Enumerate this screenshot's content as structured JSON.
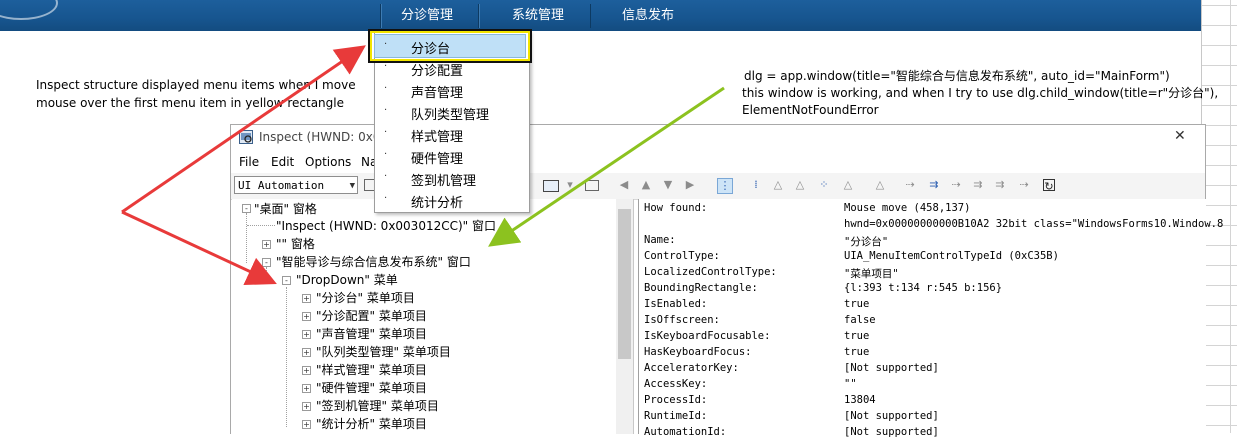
{
  "topbar": {
    "items": [
      "分诊管理",
      "系统管理",
      "信息发布"
    ],
    "bg_color": "#17558f"
  },
  "dropdown": {
    "items": [
      "分诊台",
      "分诊配置",
      "声音管理",
      "队列类型管理",
      "样式管理",
      "硬件管理",
      "签到机管理",
      "统计分析"
    ],
    "highlight_color": "#bfe0f7",
    "frame_color": "#f2e500"
  },
  "annotations": {
    "left_note": [
      "Inspect structure displayed menu items when I move",
      "mouse over the first menu item in yellow rectangle"
    ],
    "right_note": [
      "dlg = app.window(title=\"智能综合与信息发布系统\", auto_id=\"MainForm\")",
      "this window is working, and when I try to use dlg.child_window(title=r\"分诊台\"),",
      "ElementNotFoundError"
    ],
    "arrow_colors": {
      "red": "#e83a3a",
      "green": "#8cc21f"
    }
  },
  "inspect": {
    "title": "Inspect  (HWND: 0x0",
    "menu": [
      "File",
      "Edit",
      "Options",
      "Na"
    ],
    "mode": "UI Automation",
    "tree": [
      {
        "text": "\"桌面\" 窗格",
        "level": 0,
        "box": "-"
      },
      {
        "text": "\"Inspect  (HWND: 0x003012CC)\" 窗口",
        "level": 1,
        "box": ""
      },
      {
        "text": "\"\" 窗格",
        "level": 1,
        "box": "+"
      },
      {
        "text": "\"智能导诊与综合信息发布系统\" 窗口",
        "level": 1,
        "box": "-"
      },
      {
        "text": "\"DropDown\" 菜单",
        "level": 2,
        "box": "-"
      },
      {
        "text": "\"分诊台\" 菜单项目",
        "level": 3,
        "box": "+"
      },
      {
        "text": "\"分诊配置\" 菜单项目",
        "level": 3,
        "box": "+"
      },
      {
        "text": "\"声音管理\" 菜单项目",
        "level": 3,
        "box": "+"
      },
      {
        "text": "\"队列类型管理\" 菜单项目",
        "level": 3,
        "box": "+"
      },
      {
        "text": "\"样式管理\" 菜单项目",
        "level": 3,
        "box": "+"
      },
      {
        "text": "\"硬件管理\" 菜单项目",
        "level": 3,
        "box": "+"
      },
      {
        "text": "\"签到机管理\" 菜单项目",
        "level": 3,
        "box": "+"
      },
      {
        "text": "\"统计分析\" 菜单项目",
        "level": 3,
        "box": "+"
      }
    ],
    "properties": [
      {
        "k": "How found:",
        "v": "Mouse move (458,137)"
      },
      {
        "k": "",
        "v": "hwnd=0x00000000000B10A2 32bit class=\"WindowsForms10.Window.8"
      },
      {
        "k": "Name:",
        "v": "\"分诊台\""
      },
      {
        "k": "ControlType:",
        "v": "UIA_MenuItemControlTypeId (0xC35B)"
      },
      {
        "k": "LocalizedControlType:",
        "v": "\"菜单项目\""
      },
      {
        "k": "BoundingRectangle:",
        "v": "{l:393 t:134 r:545 b:156}"
      },
      {
        "k": "IsEnabled:",
        "v": "true"
      },
      {
        "k": "IsOffscreen:",
        "v": "false"
      },
      {
        "k": "IsKeyboardFocusable:",
        "v": "true"
      },
      {
        "k": "HasKeyboardFocus:",
        "v": "true"
      },
      {
        "k": "AcceleratorKey:",
        "v": "[Not supported]"
      },
      {
        "k": "AccessKey:",
        "v": "\"\""
      },
      {
        "k": "ProcessId:",
        "v": "13804"
      },
      {
        "k": "RuntimeId:",
        "v": "[Not supported]"
      },
      {
        "k": "AutomationId:",
        "v": "[Not supported]"
      }
    ]
  }
}
